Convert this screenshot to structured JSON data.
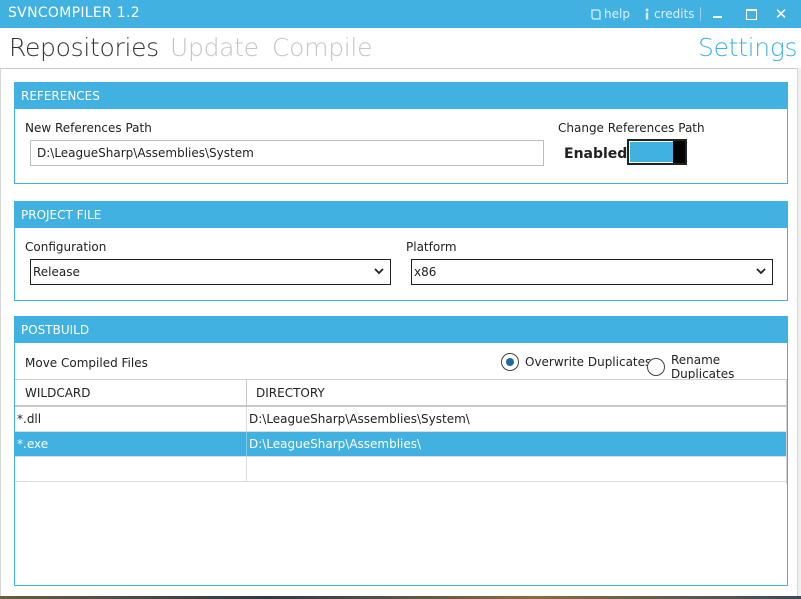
{
  "window": {
    "title": "SVNCOMPILER 1.2",
    "help_label": "help",
    "credits_label": "credits",
    "close_glyph": "✕"
  },
  "nav": {
    "tabs": [
      "Repositories",
      "Update",
      "Compile"
    ],
    "active_tab": "Repositories",
    "settings_label": "Settings"
  },
  "references": {
    "header": "REFERENCES",
    "path_label": "New References Path",
    "path_value": "D:\\LeagueSharp\\Assemblies\\System",
    "change_label": "Change References Path",
    "toggle_state_label": "Enabled",
    "toggle_on": true
  },
  "project_file": {
    "header": "PROJECT FILE",
    "configuration_label": "Configuration",
    "configuration_value": "Release",
    "platform_label": "Platform",
    "platform_value": "x86"
  },
  "postbuild": {
    "header": "POSTBUILD",
    "move_label": "Move Compiled Files",
    "overwrite_label": "Overwrite Duplicates",
    "rename_label": "Rename Duplicates",
    "selected_option": "Overwrite Duplicates",
    "columns": [
      "WILDCARD",
      "DIRECTORY"
    ],
    "rows": [
      {
        "wildcard": "*.dll",
        "directory": "D:\\LeagueSharp\\Assemblies\\System\\"
      },
      {
        "wildcard": "*.exe",
        "directory": "D:\\LeagueSharp\\Assemblies\\"
      }
    ],
    "selected_row": 1
  },
  "colors": {
    "accent": "#41b1e1",
    "inactive_tab": "#c5c5c5",
    "radio_dot": "#1b6aa8"
  },
  "icons": {
    "help": "help-book-icon",
    "credits": "info-icon",
    "dropdown": "chevron-down-icon"
  }
}
